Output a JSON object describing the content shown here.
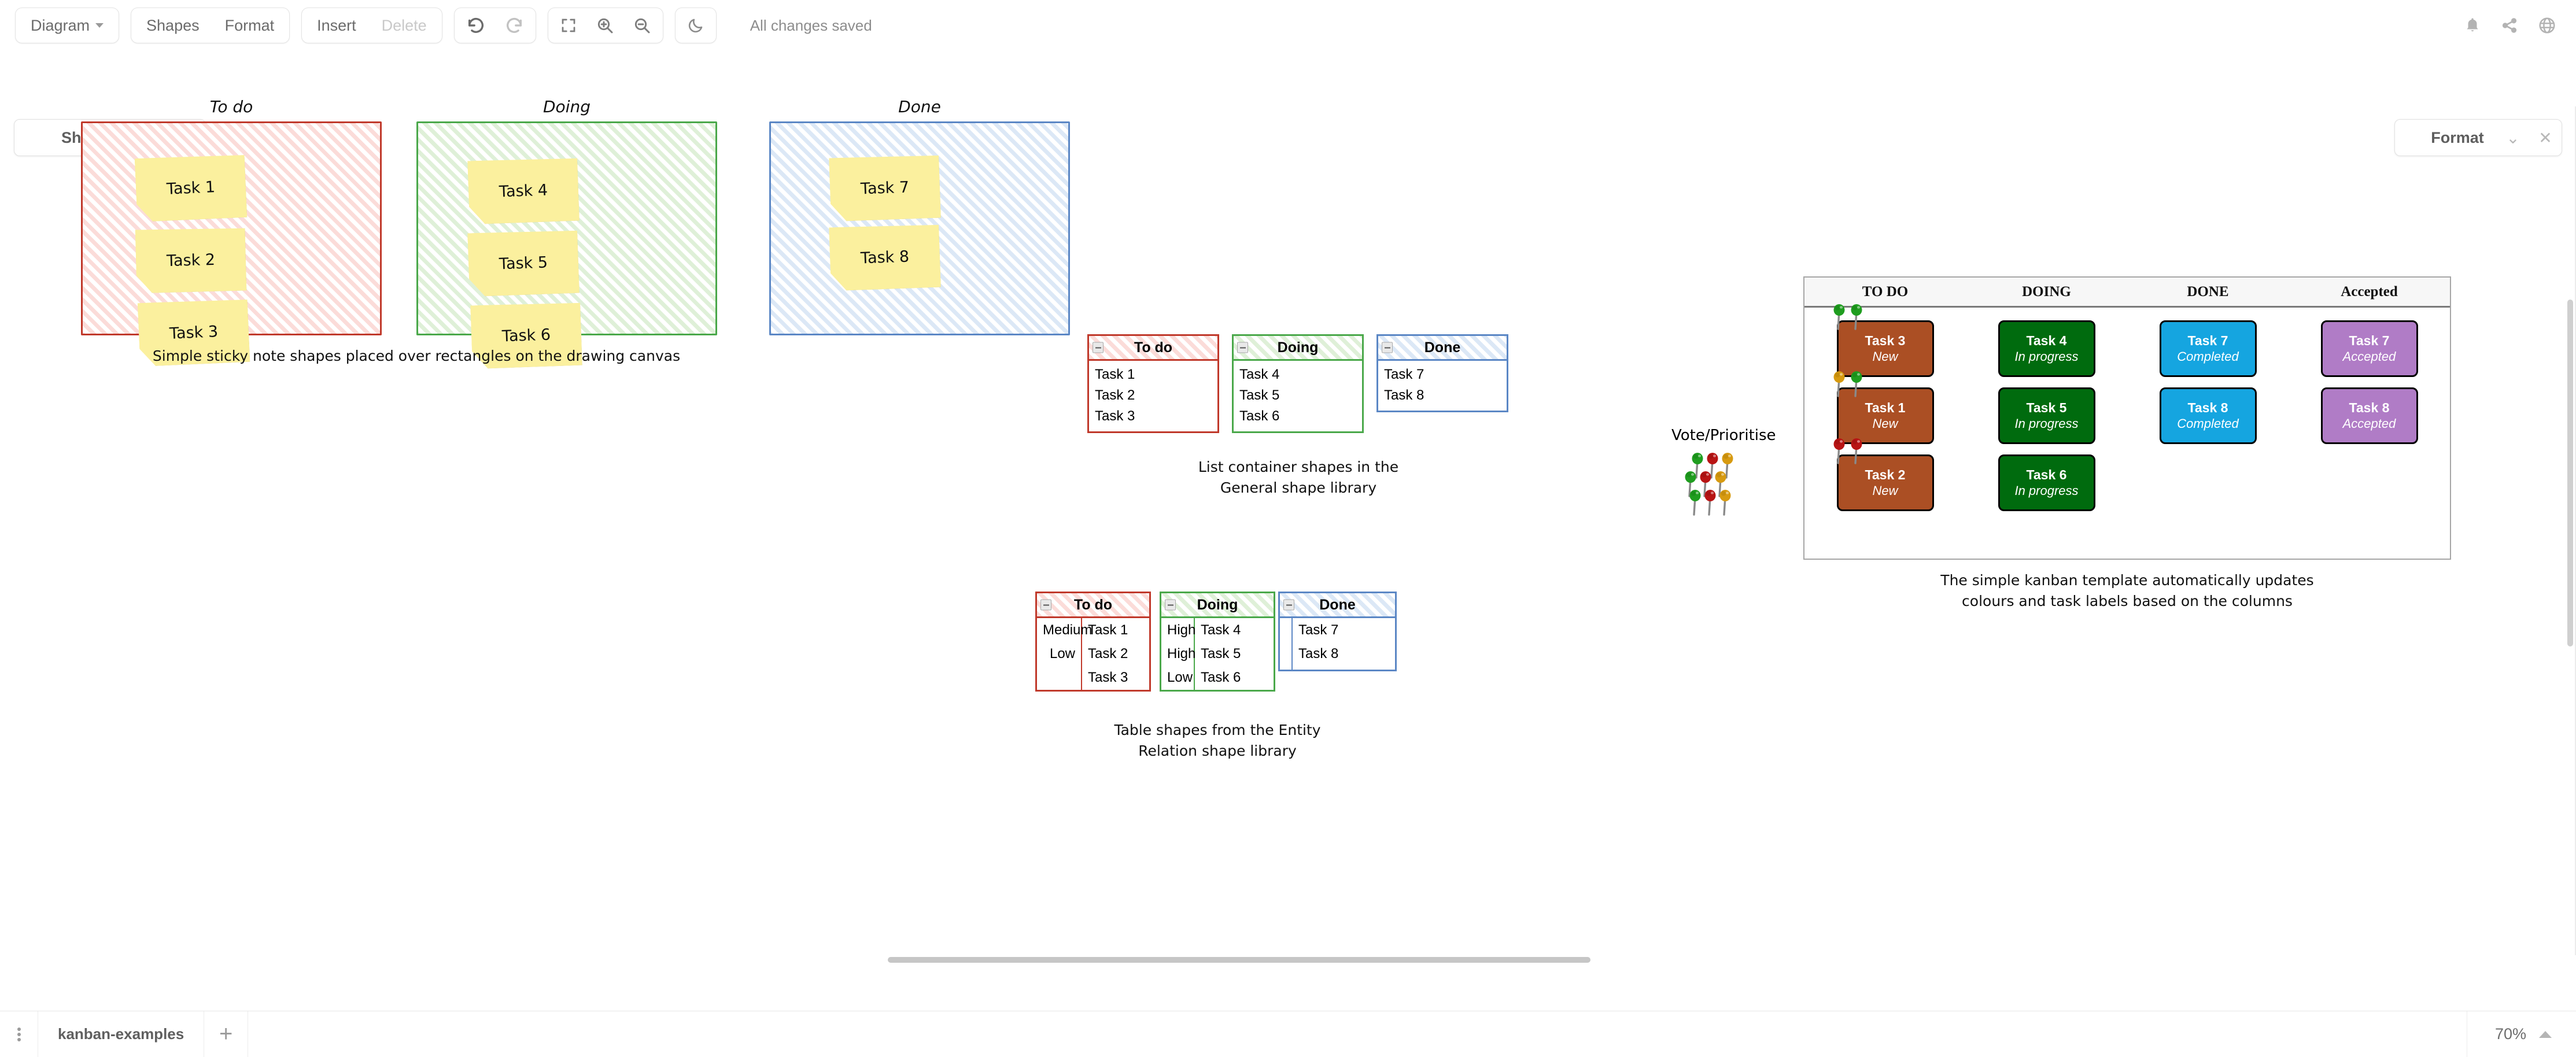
{
  "toolbar": {
    "diagram_label": "Diagram",
    "shapes_label": "Shapes",
    "format_label": "Format",
    "insert_label": "Insert",
    "delete_label": "Delete",
    "undo_icon": "undo-icon",
    "redo_icon": "redo-icon",
    "fullscreen_icon": "fullscreen-icon",
    "zoom_in_icon": "zoom-in-icon",
    "zoom_out_icon": "zoom-out-icon",
    "dark_mode_icon": "moon-icon",
    "status": "All changes saved",
    "bell_icon": "bell-icon",
    "share_icon": "share-icon",
    "language_icon": "globe-icon"
  },
  "panels": {
    "shapes": {
      "title": "Shapes",
      "collapse_icon": "chevron-down-icon",
      "close_icon": "close-icon"
    },
    "format": {
      "title": "Format",
      "collapse_icon": "chevron-down-icon",
      "close_icon": "close-icon"
    }
  },
  "canvas": {
    "sticky_section": {
      "columns": [
        {
          "title": "To do",
          "color": "#c0392b",
          "fill": "#fbdcd9",
          "notes": [
            "Task 1",
            "Task 2",
            "Task 3"
          ]
        },
        {
          "title": "Doing",
          "color": "#4aa84a",
          "fill": "#dff0d8",
          "notes": [
            "Task 4",
            "Task 5",
            "Task 6"
          ]
        },
        {
          "title": "Done",
          "color": "#5b87c5",
          "fill": "#dce8f6",
          "notes": [
            "Task 7",
            "Task 8"
          ]
        }
      ],
      "caption": "Simple sticky note shapes placed over rectangles on the drawing canvas",
      "note_fill": "#fbf09e"
    },
    "list_section": {
      "lists": [
        {
          "title": "To do",
          "color": "#c0392b",
          "fill": "#fbdcd9",
          "items": [
            "Task 1",
            "Task 2",
            "Task 3"
          ]
        },
        {
          "title": "Doing",
          "color": "#4aa84a",
          "fill": "#dff0d8",
          "items": [
            "Task 4",
            "Task 5",
            "Task 6"
          ]
        },
        {
          "title": "Done",
          "color": "#5b87c5",
          "fill": "#dce8f6",
          "items": [
            "Task 7",
            "Task 8"
          ]
        }
      ],
      "caption": "List container shapes in the\nGeneral shape library"
    },
    "table_section": {
      "tables": [
        {
          "title": "To do",
          "color": "#c0392b",
          "fill": "#fbdcd9",
          "priorities": [
            "Medium",
            "Low"
          ],
          "tasks": [
            "Task 1",
            "Task 2",
            "Task 3"
          ]
        },
        {
          "title": "Doing",
          "color": "#4aa84a",
          "fill": "#dff0d8",
          "priorities": [
            "High",
            "High",
            "Low"
          ],
          "tasks": [
            "Task 4",
            "Task 5",
            "Task 6"
          ]
        },
        {
          "title": "Done",
          "color": "#5b87c5",
          "fill": "#dce8f6",
          "priorities": [],
          "tasks": [
            "Task 7",
            "Task 8"
          ]
        }
      ],
      "caption": "Table shapes from the Entity\nRelation shape library"
    },
    "vote_section": {
      "title": "Vote/Prioritise",
      "rows": [
        [
          "green",
          "red",
          "orange"
        ],
        [
          "green",
          "red",
          "orange"
        ],
        [
          "green",
          "red",
          "orange"
        ]
      ],
      "pin_colors": {
        "green": "#1f9d1f",
        "red": "#b81414",
        "orange": "#d79a10"
      }
    },
    "kanban_section": {
      "headers": [
        "TO DO",
        "DOING",
        "DONE",
        "Accepted"
      ],
      "columns": [
        {
          "name": "TO DO",
          "color": "#ab4f24",
          "cards": [
            {
              "title": "Task 3",
              "status": "New",
              "pins": [
                "green",
                "green"
              ]
            },
            {
              "title": "Task 1",
              "status": "New",
              "pins": [
                "orange",
                "green"
              ]
            },
            {
              "title": "Task 2",
              "status": "New",
              "pins": [
                "red",
                "red"
              ]
            }
          ]
        },
        {
          "name": "DOING",
          "color": "#006b0e",
          "cards": [
            {
              "title": "Task 4",
              "status": "In progress",
              "pins": []
            },
            {
              "title": "Task 5",
              "status": "In progress",
              "pins": []
            },
            {
              "title": "Task 6",
              "status": "In progress",
              "pins": []
            }
          ]
        },
        {
          "name": "DONE",
          "color": "#15a5e0",
          "cards": [
            {
              "title": "Task 7",
              "status": "Completed",
              "pins": []
            },
            {
              "title": "Task 8",
              "status": "Completed",
              "pins": []
            }
          ]
        },
        {
          "name": "Accepted",
          "color": "#b07cc6",
          "cards": [
            {
              "title": "Task 7",
              "status": "Accepted",
              "pins": []
            },
            {
              "title": "Task 8",
              "status": "Accepted",
              "pins": []
            }
          ]
        }
      ],
      "caption": "The simple kanban template automatically updates\ncolours and task labels based on the columns"
    }
  },
  "bottombar": {
    "kebab_icon": "more-options-icon",
    "tab_label": "kanban-examples",
    "add_icon": "add-page-icon",
    "zoom_level": "70%",
    "zoom_caret_icon": "caret-up-icon"
  }
}
